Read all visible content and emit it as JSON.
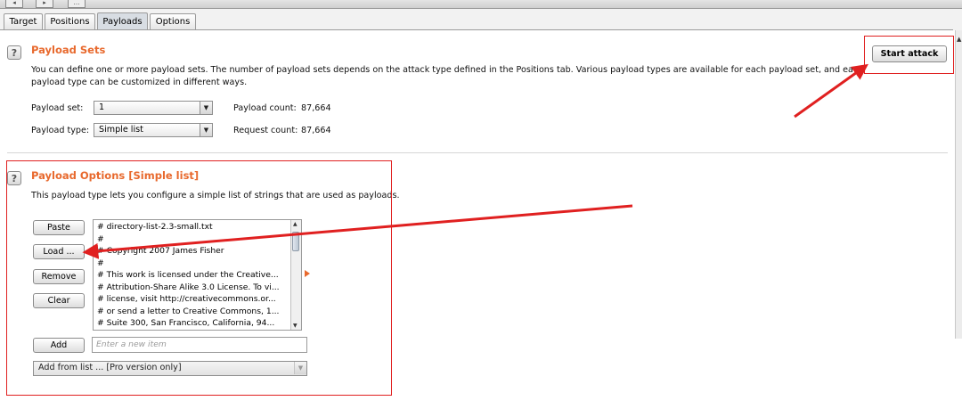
{
  "tabs": [
    {
      "label": "Target"
    },
    {
      "label": "Positions"
    },
    {
      "label": "Payloads",
      "active": true
    },
    {
      "label": "Options"
    }
  ],
  "payload_sets": {
    "title": "Payload Sets",
    "description_line1": "You can define one or more payload sets. The number of payload sets depends on the attack type defined in the Positions tab. Various payload types are available for each payload set, and each",
    "description_line2": "payload type can be customized in different ways.",
    "payload_set_label": "Payload set:",
    "payload_set_value": "1",
    "payload_type_label": "Payload type:",
    "payload_type_value": "Simple list",
    "payload_count_label": "Payload count:",
    "payload_count_value": "87,664",
    "request_count_label": "Request count:",
    "request_count_value": "87,664",
    "start_attack_label": "Start attack"
  },
  "payload_options": {
    "title": "Payload Options [Simple list]",
    "description": "This payload type lets you configure a simple list of strings that are used as payloads.",
    "buttons": {
      "paste": "Paste",
      "load": "Load ...",
      "remove": "Remove",
      "clear": "Clear",
      "add": "Add"
    },
    "list_items": [
      "# directory-list-2.3-small.txt",
      "#",
      "# Copyright 2007 James Fisher",
      "#",
      "# This work is licensed under the Creative...",
      "# Attribution-Share Alike 3.0 License. To vi...",
      "# license, visit http://creativecommons.or...",
      "# or send a letter to Creative Commons, 1...",
      "# Suite 300, San Francisco, California, 94..."
    ],
    "new_item_placeholder": "Enter a new item",
    "add_from_list_label": "Add from list ... [Pro version only]"
  },
  "colors": {
    "accent_orange": "#e8692d",
    "annotation_red": "#e02020"
  }
}
